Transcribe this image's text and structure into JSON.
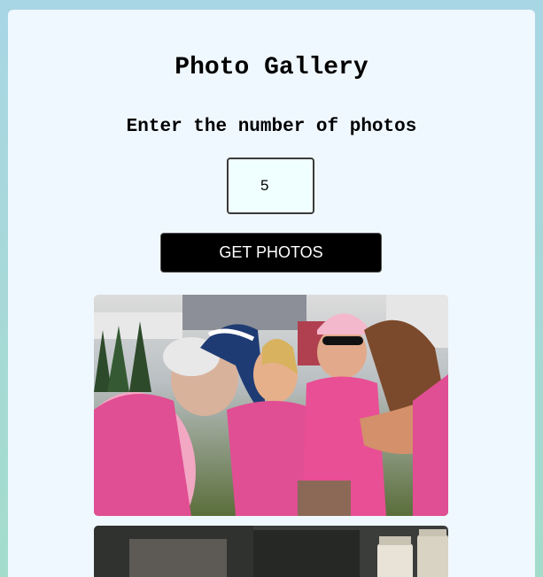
{
  "page": {
    "title": "Photo Gallery",
    "prompt": "Enter the number of photos"
  },
  "form": {
    "count_value": "5",
    "button_label": "GET PHOTOS"
  },
  "photos": [
    {
      "description_icon": "photo-pink-walkers"
    },
    {
      "description_icon": "photo-kitchen-jars"
    }
  ],
  "colors": {
    "background_top": "#a9d6e5",
    "background_bottom": "#a3dccb",
    "card": "#f0f8ff",
    "button": "#000000",
    "button_text": "#ffffff",
    "input_bg": "#f0ffff"
  }
}
